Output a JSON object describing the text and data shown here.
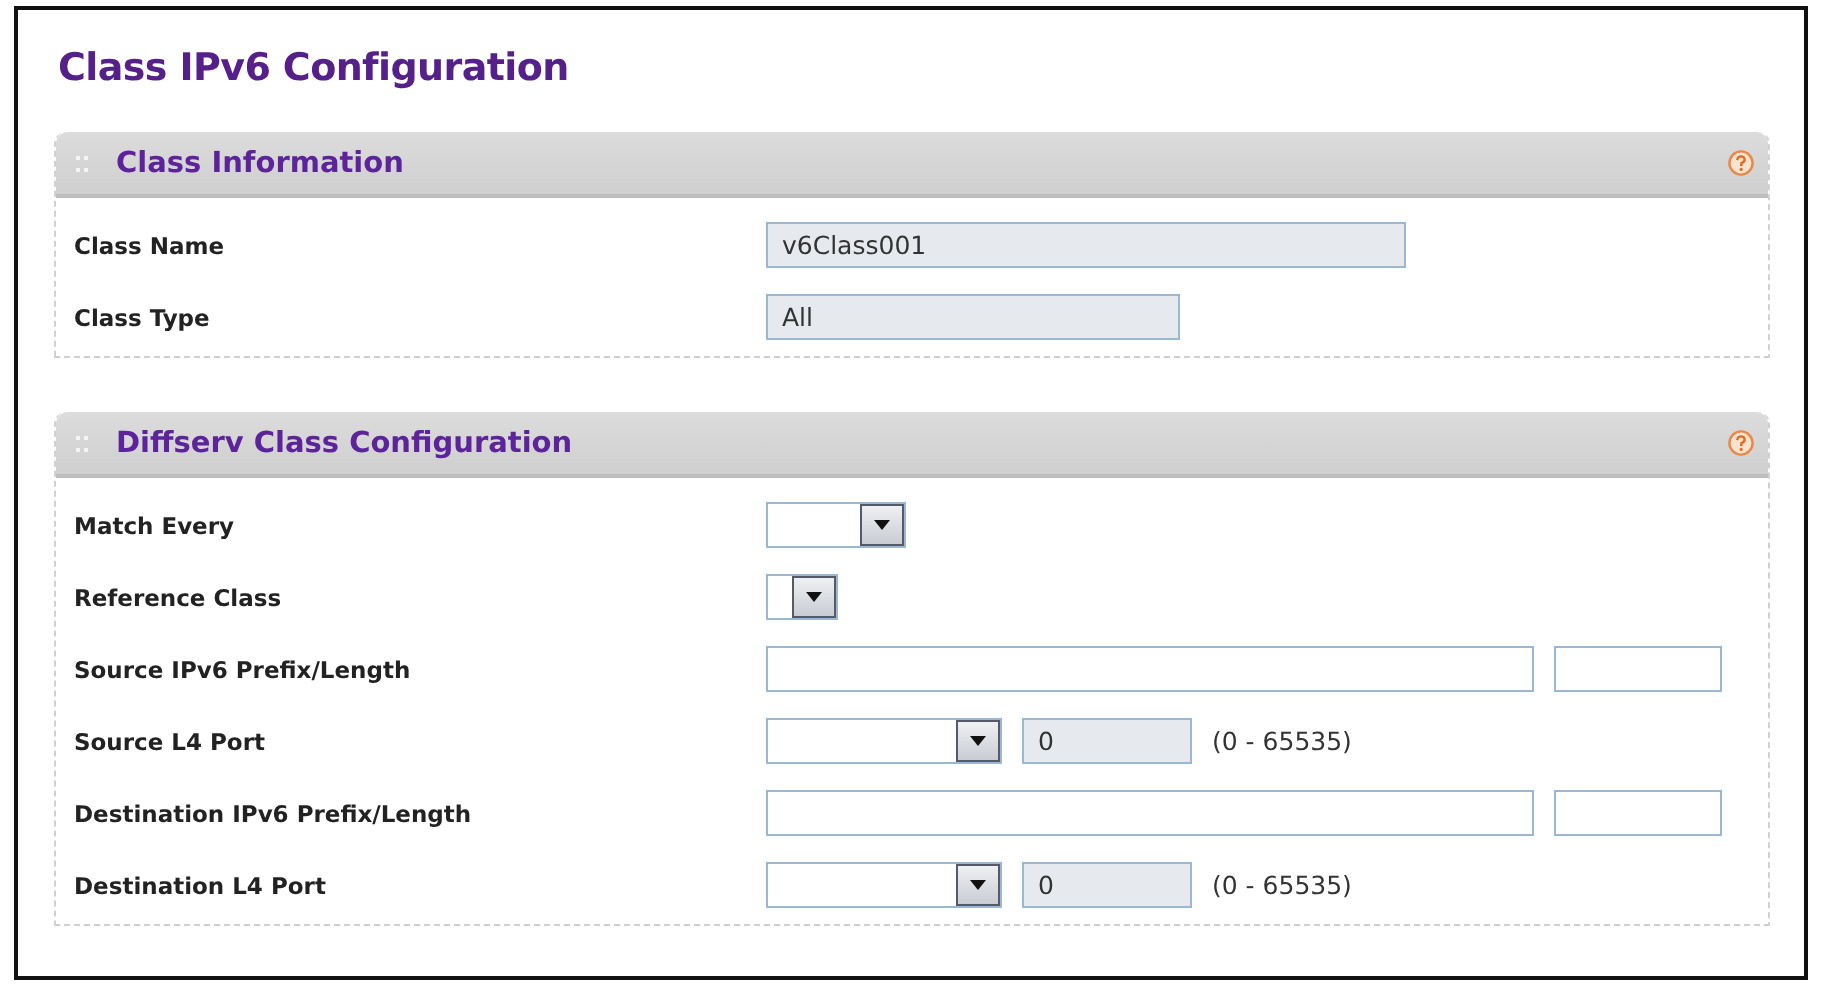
{
  "page": {
    "title": "Class IPv6 Configuration"
  },
  "sections": [
    {
      "title": "Class Information",
      "rows": [
        {
          "label": "Class Name",
          "kind": "text",
          "value": "v6Class001"
        },
        {
          "label": "Class Type",
          "kind": "shorttext",
          "value": "All"
        }
      ]
    },
    {
      "title": "Diffserv Class Configuration",
      "rows": [
        {
          "label": "Match Every",
          "kind": "select"
        },
        {
          "label": "Reference Class",
          "kind": "narrowselect"
        },
        {
          "label": "Source IPv6 Prefix/Length",
          "kind": "prefix"
        },
        {
          "label": "Source L4 Port",
          "kind": "port",
          "value": "0",
          "range": "(0 - 65535)"
        },
        {
          "label": "Destination IPv6 Prefix/Length",
          "kind": "prefix"
        },
        {
          "label": "Destination L4 Port",
          "kind": "port",
          "value": "0",
          "range": "(0 - 65535)"
        }
      ]
    }
  ]
}
